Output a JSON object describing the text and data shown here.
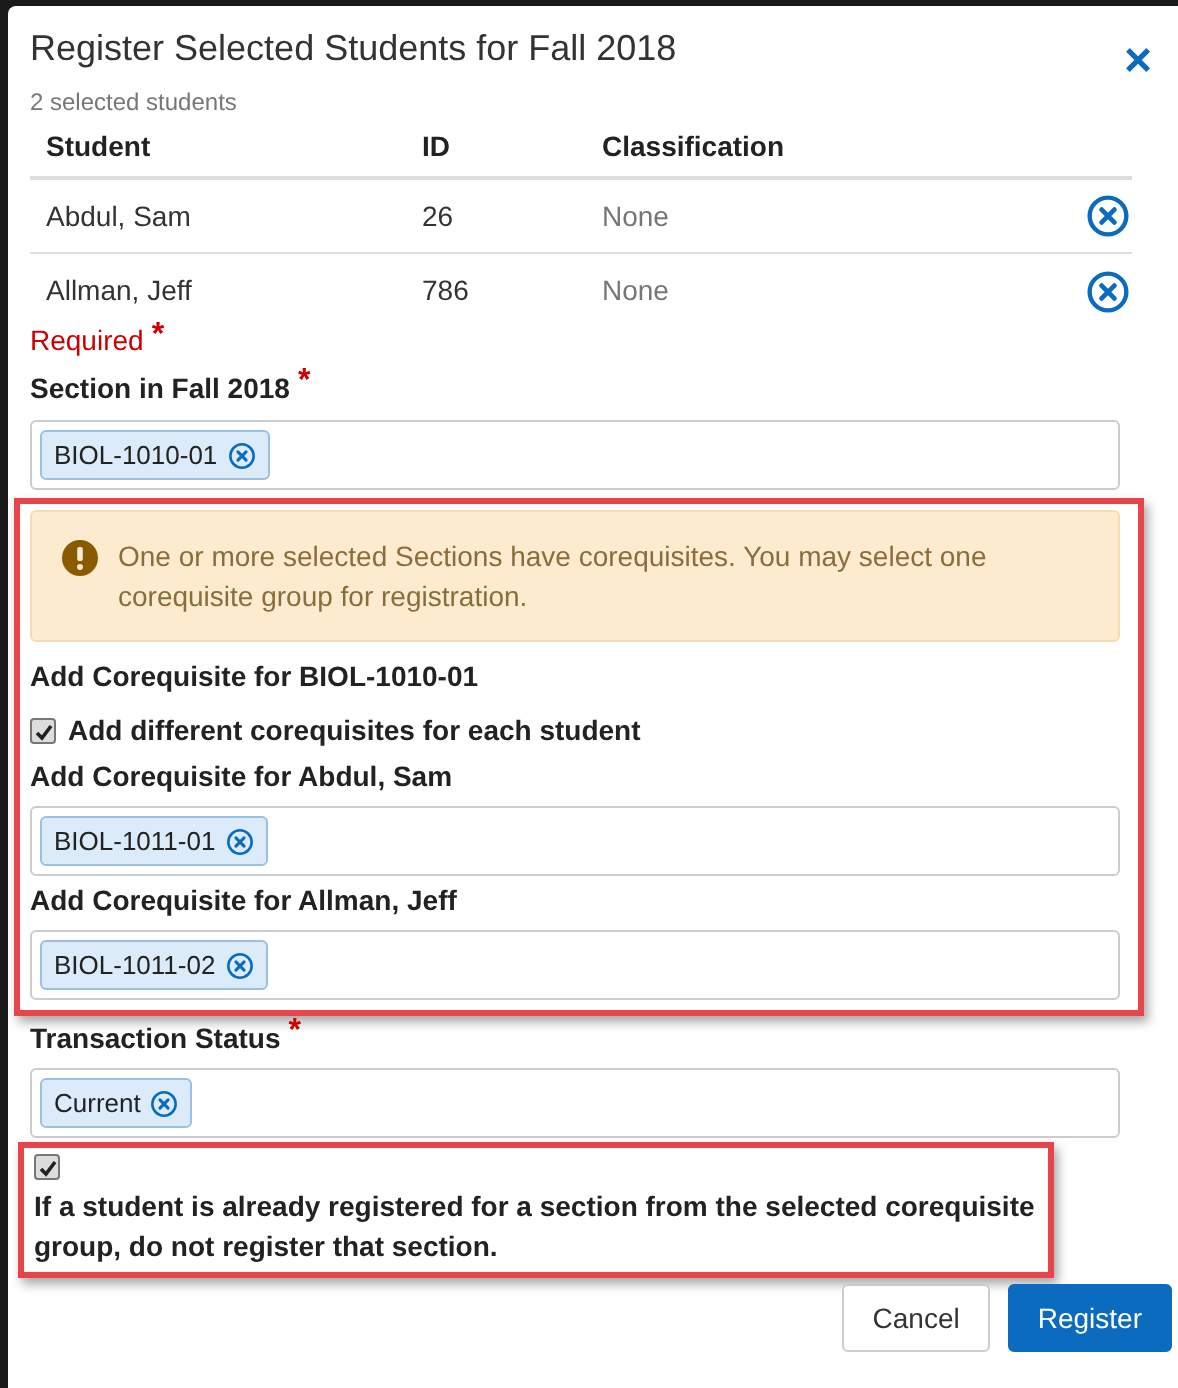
{
  "dialog": {
    "title": "Register Selected Students for Fall 2018",
    "close_icon": "×",
    "subtitle": "2 selected students"
  },
  "table": {
    "columns": [
      "Student",
      "ID",
      "Classification"
    ],
    "rows": [
      {
        "student": "Abdul, Sam",
        "id": "26",
        "classification": "None"
      },
      {
        "student": "Allman, Jeff",
        "id": "786",
        "classification": "None"
      }
    ]
  },
  "required_note": {
    "text": "Required",
    "mark": "*"
  },
  "section_field": {
    "label": "Section in Fall 2018",
    "required": true,
    "tags": [
      "BIOL-1010-01"
    ]
  },
  "corequisites": {
    "highlighted": true,
    "alert": "One or more selected Sections have corequisites. You may select one corequisite group for registration.",
    "heading": "Add Corequisite for BIOL-1010-01",
    "per_student": {
      "label": "Add different corequisites for each student",
      "checked": true
    },
    "fields": [
      {
        "label": "Add Corequisite for Abdul, Sam",
        "required": false,
        "tags": [
          "BIOL-1011-01"
        ]
      },
      {
        "label": "Add Corequisite for Allman, Jeff",
        "required": false,
        "tags": [
          "BIOL-1011-02"
        ]
      }
    ]
  },
  "status_field": {
    "label": "Transaction Status",
    "required": true,
    "tags": [
      "Current"
    ]
  },
  "skip_option": {
    "highlighted": true,
    "checked": true,
    "label": "If a student is already registered for a section from the selected corequisite group, do not register that section."
  },
  "buttons": [
    {
      "label": "Cancel",
      "kind": "secondary"
    },
    {
      "label": "Register",
      "kind": "primary"
    }
  ]
}
